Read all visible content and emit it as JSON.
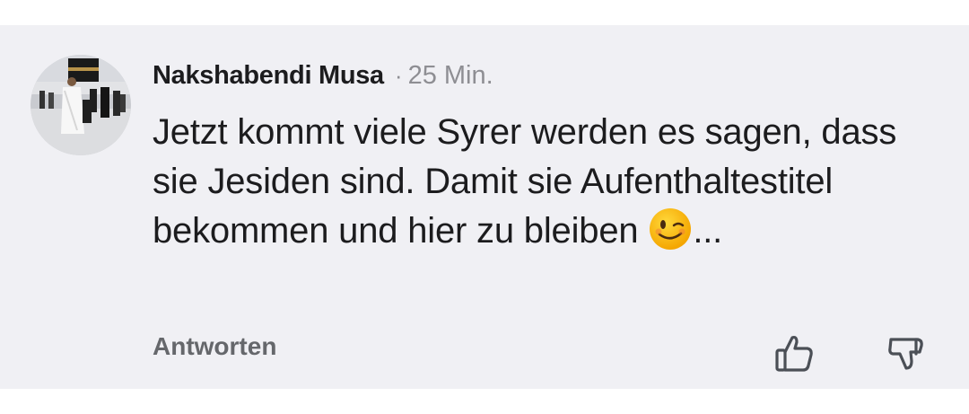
{
  "comment": {
    "author": "Nakshabendi Musa",
    "separator": "·",
    "time": "25 Min.",
    "text": "Jetzt kommt viele Syrer werden es sagen, dass sie Jesiden sind. Damit sie Aufenthaltestitel bekommen und hier zu bleiben",
    "emoji": "winking-face-emoji",
    "text_suffix": "...",
    "reply_label": "Antworten"
  },
  "icons": {
    "like": "thumbs-up-icon",
    "dislike": "thumbs-down-icon"
  },
  "colors": {
    "card_background": "#f0f0f4",
    "author": "#1c1c1e",
    "meta": "#8e8e93",
    "reply": "#65676b",
    "icon": "#4b4f56"
  }
}
